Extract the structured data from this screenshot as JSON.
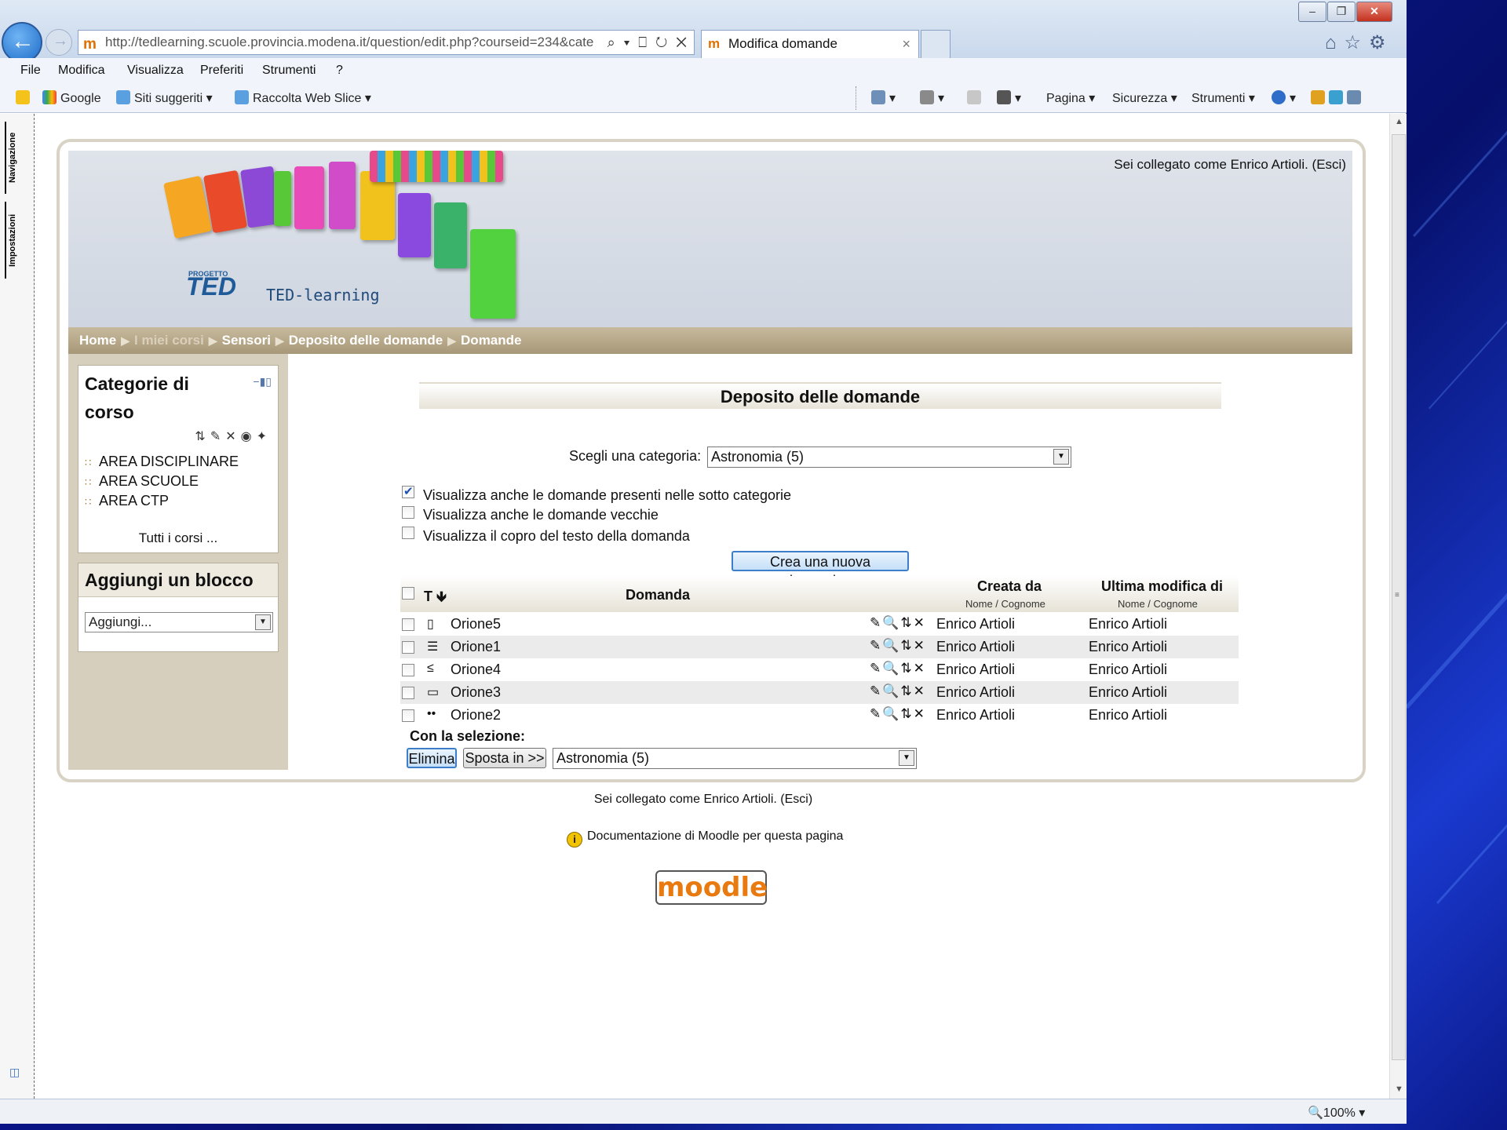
{
  "browser": {
    "address": "http://tedlearning.scuole.provincia.modena.it/question/edit.php?courseid=234&cate",
    "address_controls": "⌕ ▾ ⎕ ↻ ✕",
    "tab_title": "Modifica domande",
    "tab_close": "×",
    "back_glyph": "←",
    "fwd_glyph": "→",
    "minimize_glyph": "–",
    "maximize_glyph": "❐",
    "close_glyph": "✕",
    "right_icons": "⌂☆⚙",
    "menu": [
      "File",
      "Modifica",
      "Visualizza",
      "Preferiti",
      "Strumenti",
      "?"
    ],
    "favorites": [
      "Google",
      "Siti suggeriti ▾",
      "Raccolta Web Slice ▾"
    ],
    "command_bar": [
      "▾",
      "▾",
      "▾",
      "Pagina ▾",
      "Sicurezza ▾",
      "Strumenti ▾",
      "▾"
    ],
    "side_tabs": [
      "Navigazione",
      "Impostazioni"
    ],
    "zoom": "🔍100%  ▾",
    "scroll_up": "▲",
    "scroll_down": "▼",
    "scroll_grip": "≡",
    "side_icon": "◫"
  },
  "site": {
    "logged_in_top": "Sei collegato come Enrico Artioli. (Esci)",
    "logo_small": "PROGETTO",
    "logo_ted": "TED",
    "logo_text": "TED-learning",
    "breadcrumb": [
      "Home",
      "I miei corsi",
      "Sensori",
      "Deposito delle domande",
      "Domande"
    ],
    "breadcrumb_sep": "▶"
  },
  "left": {
    "block1_title": "Categorie di corso",
    "block1_hide": "−▮▯",
    "block1_icons": "⇅✎✕◉✦",
    "categories": [
      "AREA DISCIPLINARE",
      "AREA SCUOLE",
      "AREA CTP"
    ],
    "category_icon": "∷",
    "all_courses": "Tutti i corsi ...",
    "block2_title": "Aggiungi un blocco",
    "add_select": "Aggiungi...",
    "dd_arrow": "▼"
  },
  "main": {
    "heading": "Deposito delle domande",
    "category_label": "Scegli una categoria:",
    "category_value": "Astronomia (5)",
    "options": [
      {
        "label": "Visualizza anche le domande presenti nelle sotto categorie",
        "checked": true
      },
      {
        "label": "Visualizza anche le domande vecchie",
        "checked": false
      },
      {
        "label": "Visualizza il copro del testo della domanda",
        "checked": false
      }
    ],
    "create_button": "Crea una nuova domanda...",
    "table": {
      "col_type": "T",
      "sort_arrow": "🡻",
      "col_question": "Domanda",
      "col_created": "Creata da",
      "col_created_sub": "Nome / Cognome",
      "col_modified": "Ultima modifica di",
      "col_modified_sub": "Nome / Cognome",
      "action_icons": "✎🔍⇅✕",
      "rows": [
        {
          "type_icon": "▯",
          "name": "Orione5",
          "created": "Enrico Artioli",
          "modified": "Enrico Artioli"
        },
        {
          "type_icon": "☰",
          "name": "Orione1",
          "created": "Enrico Artioli",
          "modified": "Enrico Artioli"
        },
        {
          "type_icon": "≤",
          "name": "Orione4",
          "created": "Enrico Artioli",
          "modified": "Enrico Artioli"
        },
        {
          "type_icon": "▭",
          "name": "Orione3",
          "created": "Enrico Artioli",
          "modified": "Enrico Artioli"
        },
        {
          "type_icon": "••",
          "name": "Orione2",
          "created": "Enrico Artioli",
          "modified": "Enrico Artioli"
        }
      ]
    },
    "with_selection": "Con la selezione:",
    "delete_button": "Elimina",
    "move_button": "Sposta in >>",
    "move_target": "Astronomia (5)"
  },
  "footer": {
    "logged_in": "Sei collegato come Enrico Artioli. (Esci)",
    "docs_icon": "i",
    "docs": "Documentazione di Moodle per questa pagina",
    "logo": "moodle"
  },
  "colors": {
    "breadcrumb_bg": "#a8987a",
    "left_column_bg": "#d6cfbd",
    "button_focus": "#3c7fc8"
  }
}
